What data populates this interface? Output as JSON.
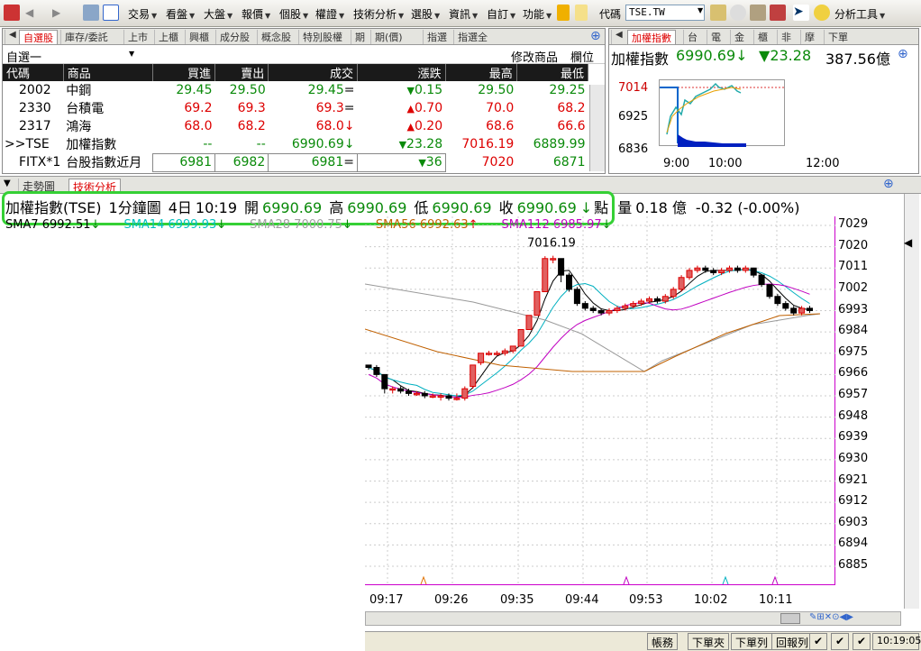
{
  "toolbar": {
    "items": [
      {
        "label": "交易",
        "x": 142
      },
      {
        "label": "看盤",
        "x": 184
      },
      {
        "label": "大盤",
        "x": 226
      },
      {
        "label": "報價",
        "x": 268
      },
      {
        "label": "個股",
        "x": 310
      },
      {
        "label": "權證",
        "x": 350
      },
      {
        "label": "技術分析",
        "x": 392
      },
      {
        "label": "選股",
        "x": 456
      },
      {
        "label": "資訊",
        "x": 498
      },
      {
        "label": "自訂",
        "x": 540
      },
      {
        "label": "功能",
        "x": 580
      }
    ],
    "code_label": "代碼",
    "code_value": "TSE.TW",
    "analysis_tools": "分析工具"
  },
  "quote": {
    "tabs": [
      "自選股",
      "庫存/委託",
      "上市",
      "上櫃",
      "興櫃",
      "成分股",
      "概念股",
      "特別股權",
      "期",
      "期(價)",
      "指選",
      "指選全"
    ],
    "watchlist": "自選一",
    "edit_label": "修改商品",
    "column_label": "欄位",
    "headers": [
      "代碼",
      "商品",
      "買進",
      "賣出",
      "成交",
      "漲跌",
      "最高",
      "最低"
    ],
    "rows": [
      {
        "code": "2002",
        "name": "中鋼",
        "bid": "29.45",
        "ask": "29.50",
        "last": "29.45",
        "mark": "=",
        "chg": "0.15",
        "dir": "down",
        "high": "29.50",
        "low": "29.25",
        "color": "g"
      },
      {
        "code": "2330",
        "name": "台積電",
        "bid": "69.2",
        "ask": "69.3",
        "last": "69.3",
        "mark": "=",
        "chg": "0.70",
        "dir": "up",
        "high": "70.0",
        "low": "68.2",
        "color": "r"
      },
      {
        "code": "2317",
        "name": "鴻海",
        "bid": "68.0",
        "ask": "68.2",
        "last": "68.0",
        "mark": "↓",
        "chg": "0.20",
        "dir": "up",
        "high": "68.6",
        "low": "66.6",
        "color": "r"
      },
      {
        "code": ">>TSE",
        "name": "加權指數",
        "bid": "--",
        "ask": "--",
        "last": "6990.69",
        "mark": "↓",
        "chg": "23.28",
        "dir": "down",
        "high": "7016.19",
        "low": "6889.99",
        "color": "g"
      },
      {
        "code": "FITX*1",
        "name": "台股指數近月",
        "bid": "6981",
        "ask": "6982",
        "last": "6981",
        "mark": "=",
        "chg": "36",
        "dir": "down",
        "high": "7020",
        "low": "6871",
        "color": "g"
      }
    ]
  },
  "index": {
    "tabs": [
      "加權指數",
      "台",
      "電",
      "金",
      "櫃",
      "非",
      "摩",
      "下單"
    ],
    "name": "加權指數",
    "value": "6990.69",
    "change": "23.28",
    "volume": "387.56億",
    "y_ticks": [
      "7014",
      "6925",
      "6836"
    ],
    "x_ticks": [
      "9:00",
      "10:00",
      "12:00"
    ]
  },
  "tech": {
    "tabs": [
      "走勢圖",
      "技術分析"
    ],
    "header": {
      "name": "加權指數(TSE)",
      "period": "1分鐘圖",
      "date": "4日",
      "time": "10:19",
      "open_label": "開",
      "open": "6990.69",
      "high_label": "高",
      "high": "6990.69",
      "low_label": "低",
      "low": "6990.69",
      "close_label": "收",
      "close": "6990.69",
      "unit": "點",
      "vol_label": "量",
      "vol": "0.18 億",
      "chg": "-0.32 (-0.00%)"
    },
    "sma": [
      {
        "label": "SMA7 6992.51",
        "color": "#000000"
      },
      {
        "label": "SMA14 6999.93",
        "color": "#00c0c0"
      },
      {
        "label": "SMA28 7000.75",
        "color": "#a0a0a0"
      },
      {
        "label": "SMA56 6992.63",
        "color": "#c06000"
      },
      {
        "label": "SMA112 6985.97",
        "color": "#c000c0"
      }
    ]
  },
  "chart_data": {
    "type": "candlestick",
    "peak_label": "7016.19",
    "y_ticks": [
      "7029",
      "7020",
      "7011",
      "7002",
      "6993",
      "6984",
      "6975",
      "6966",
      "6957",
      "6948",
      "6939",
      "6930",
      "6921",
      "6912",
      "6903",
      "6894",
      "6885"
    ],
    "x_ticks": [
      "09:17",
      "09:26",
      "09:35",
      "09:44",
      "09:53",
      "10:02",
      "10:11"
    ],
    "candles": [
      [
        6970,
        6970,
        6968,
        6969
      ],
      [
        6969,
        6970,
        6965,
        6966
      ],
      [
        6966,
        6966,
        6958,
        6960
      ],
      [
        6960,
        6961,
        6958,
        6960
      ],
      [
        6960,
        6961,
        6958,
        6959
      ],
      [
        6959,
        6960,
        6957,
        6958
      ],
      [
        6958,
        6959,
        6957,
        6958
      ],
      [
        6958,
        6959,
        6956,
        6957
      ],
      [
        6957,
        6958,
        6956,
        6957
      ],
      [
        6957,
        6958,
        6955,
        6957
      ],
      [
        6957,
        6958,
        6955,
        6956
      ],
      [
        6956,
        6958,
        6955,
        6956
      ],
      [
        6956,
        6961,
        6955,
        6960
      ],
      [
        6961,
        6970,
        6960,
        6970
      ],
      [
        6971,
        6975,
        6970,
        6975
      ],
      [
        6975,
        6976,
        6974,
        6975
      ],
      [
        6975,
        6976,
        6974,
        6975
      ],
      [
        6975,
        6977,
        6974,
        6976
      ],
      [
        6976,
        6978,
        6975,
        6978
      ],
      [
        6978,
        6985,
        6978,
        6985
      ],
      [
        6985,
        6991,
        6985,
        6991
      ],
      [
        6991,
        7001,
        6991,
        7001
      ],
      [
        7001,
        7016,
        7001,
        7015
      ],
      [
        7015,
        7016.19,
        7013,
        7015
      ],
      [
        7015,
        7015,
        7005,
        7008
      ],
      [
        7008,
        7009,
        7001,
        7002
      ],
      [
        7002,
        7003,
        6995,
        6996
      ],
      [
        6996,
        6997,
        6993,
        6994
      ],
      [
        6994,
        6995,
        6992,
        6993
      ],
      [
        6993,
        6994,
        6991,
        6992
      ],
      [
        6992,
        6994,
        6991,
        6993
      ],
      [
        6993,
        6995,
        6992,
        6994
      ],
      [
        6994,
        6996,
        6993,
        6995
      ],
      [
        6995,
        6997,
        6994,
        6996
      ],
      [
        6996,
        6998,
        6995,
        6997
      ],
      [
        6997,
        6999,
        6996,
        6998
      ],
      [
        6998,
        6999,
        6996,
        6997
      ],
      [
        6997,
        7000,
        6996,
        6999
      ],
      [
        6999,
        7003,
        6998,
        7002
      ],
      [
        7002,
        7008,
        7001,
        7007
      ],
      [
        7007,
        7011,
        7006,
        7010
      ],
      [
        7010,
        7012,
        7009,
        7011
      ],
      [
        7011,
        7012,
        7009,
        7010
      ],
      [
        7010,
        7011,
        7008,
        7009
      ],
      [
        7009,
        7011,
        7008,
        7010
      ],
      [
        7010,
        7012,
        7009,
        7011
      ],
      [
        7011,
        7012,
        7009,
        7010
      ],
      [
        7010,
        7012,
        7009,
        7011
      ],
      [
        7011,
        7011,
        7007,
        7008
      ],
      [
        7008,
        7008,
        7003,
        7004
      ],
      [
        7004,
        7004,
        6998,
        6999
      ],
      [
        6999,
        7000,
        6995,
        6996
      ],
      [
        6996,
        6997,
        6993,
        6994
      ],
      [
        6994,
        6995,
        6991,
        6992
      ],
      [
        6992,
        6995,
        6991,
        6994
      ],
      [
        6994,
        6995,
        6992,
        6993
      ]
    ]
  },
  "statusbar": {
    "buttons": [
      "帳務",
      "下單夾",
      "下單列",
      "回報列"
    ],
    "clock": "10:19:05"
  }
}
